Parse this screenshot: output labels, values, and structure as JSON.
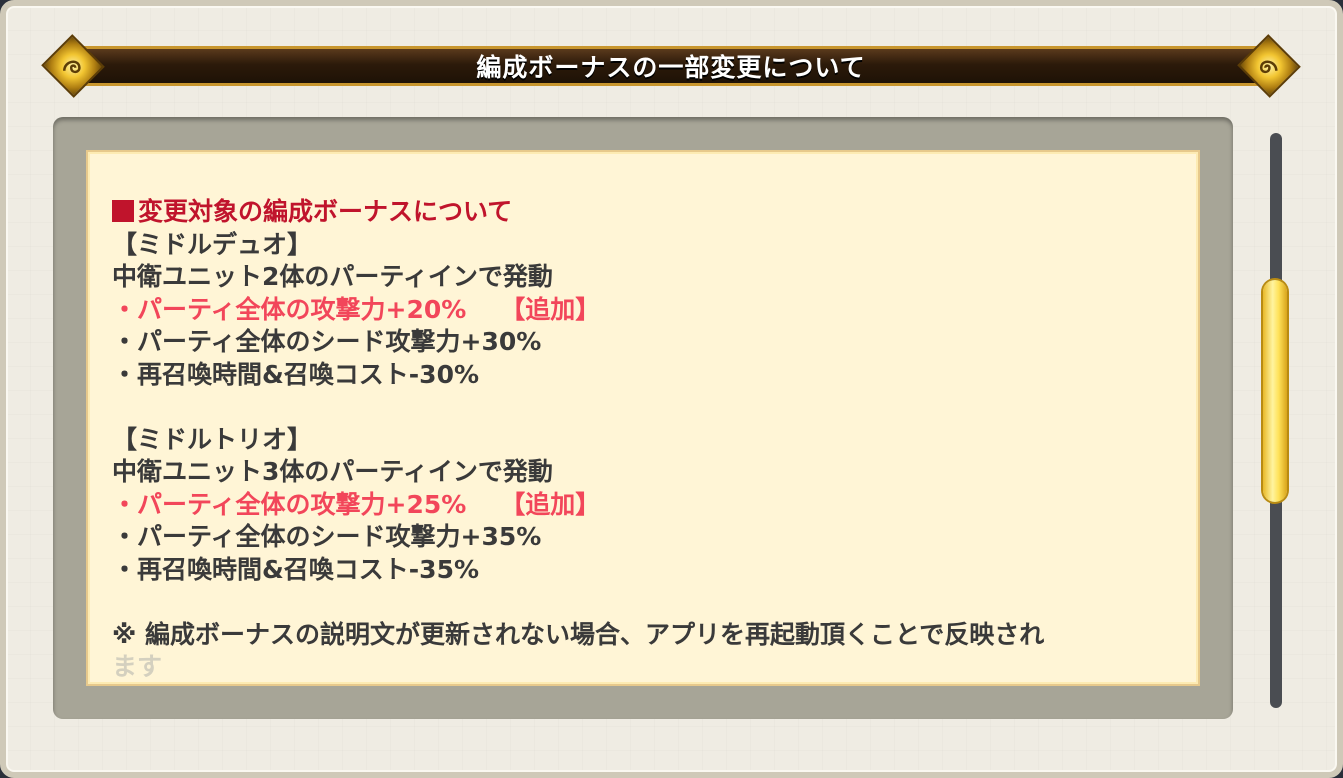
{
  "dialog": {
    "title": "編成ボーナスの一部変更について"
  },
  "content": {
    "heading": "変更対象の編成ボーナスについて",
    "sections": [
      {
        "name": "【ミドルデュオ】",
        "condition": "中衛ユニット2体のパーティインで発動",
        "effects": [
          {
            "text": "・パーティ全体の攻撃力+20%",
            "tag": "【追加】"
          },
          {
            "text": "・パーティ全体のシード攻撃力+30%"
          },
          {
            "text": "・再召喚時間&召喚コスト-30%"
          }
        ]
      },
      {
        "name": "【ミドルトリオ】",
        "condition": "中衛ユニット3体のパーティインで発動",
        "effects": [
          {
            "text": "・パーティ全体の攻撃力+25%",
            "tag": "【追加】"
          },
          {
            "text": "・パーティ全体のシード攻撃力+35%"
          },
          {
            "text": "・再召喚時間&召喚コスト-35%"
          }
        ]
      }
    ],
    "note": "※ 編成ボーナスの説明文が更新されない場合、アプリを再起動頂くことで反映され",
    "note_cut": "ます"
  },
  "colors": {
    "heading": "#c0142c",
    "added_effect": "#f2465a",
    "body_text": "#3a3a3a",
    "panel_bg": "#fff5d6",
    "banner_gold": "#c8962e",
    "scroll_thumb": "#ffe25a"
  },
  "icons": {
    "banner_ornament": "gold-swirl-ornament-icon",
    "heading_marker": "red-square-marker-icon"
  }
}
